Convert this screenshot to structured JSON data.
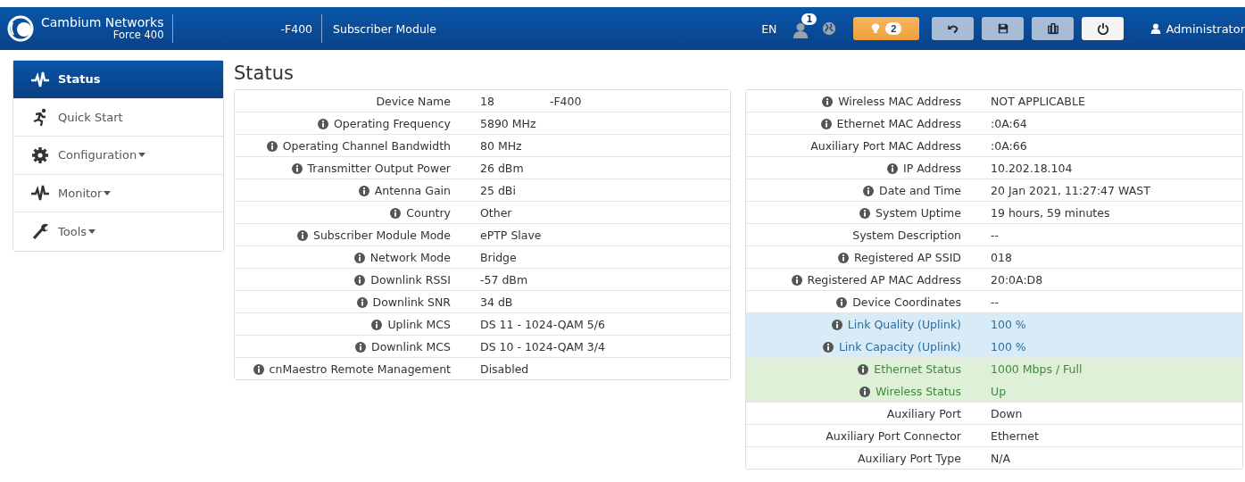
{
  "header": {
    "brand": "Cambium Networks",
    "model": "Force 400",
    "device_name": "-F400",
    "mode": "Subscriber Module",
    "language": "EN",
    "user_badge": "1",
    "alerts_badge": "2",
    "user": "Administrator"
  },
  "sidebar": {
    "items": [
      {
        "label": "Status",
        "dropdown": false,
        "selected": true
      },
      {
        "label": "Quick Start",
        "dropdown": false,
        "selected": false
      },
      {
        "label": "Configuration",
        "dropdown": true,
        "selected": false
      },
      {
        "label": "Monitor",
        "dropdown": true,
        "selected": false
      },
      {
        "label": "Tools",
        "dropdown": true,
        "selected": false
      }
    ]
  },
  "page_title": "Status",
  "left_table": {
    "rows": [
      {
        "label": "Device Name",
        "info": false,
        "value_parts": [
          "18",
          "-F400"
        ]
      },
      {
        "label": "Operating Frequency",
        "info": true,
        "value_parts": [
          "5890 MHz"
        ]
      },
      {
        "label": "Operating Channel Bandwidth",
        "info": true,
        "value_parts": [
          "80 MHz"
        ]
      },
      {
        "label": "Transmitter Output Power",
        "info": true,
        "value_parts": [
          "26 dBm"
        ]
      },
      {
        "label": "Antenna Gain",
        "info": true,
        "value_parts": [
          "25 dBi"
        ]
      },
      {
        "label": "Country",
        "info": true,
        "value_parts": [
          "Other"
        ]
      },
      {
        "label": "Subscriber Module Mode",
        "info": true,
        "value_parts": [
          "ePTP Slave"
        ]
      },
      {
        "label": "Network Mode",
        "info": true,
        "value_parts": [
          "Bridge"
        ]
      },
      {
        "label": "Downlink RSSI",
        "info": true,
        "value_parts": [
          "-57 dBm"
        ]
      },
      {
        "label": "Downlink SNR",
        "info": true,
        "value_parts": [
          "34 dB"
        ]
      },
      {
        "label": "Uplink MCS",
        "info": true,
        "value_parts": [
          "DS 11 - 1024-QAM 5/6"
        ]
      },
      {
        "label": "Downlink MCS",
        "info": true,
        "value_parts": [
          "DS 10 - 1024-QAM 3/4"
        ]
      },
      {
        "label": "cnMaestro Remote Management",
        "info": true,
        "value_parts": [
          "Disabled"
        ]
      }
    ]
  },
  "right_table": {
    "rows": [
      {
        "label": "Wireless MAC Address",
        "info": true,
        "value_parts": [
          "NOT APPLICABLE"
        ]
      },
      {
        "label": "Ethernet MAC Address",
        "info": true,
        "value_parts": [
          ":0A:64"
        ]
      },
      {
        "label": "Auxiliary Port MAC Address",
        "info": false,
        "value_parts": [
          ":0A:66"
        ]
      },
      {
        "label": "IP Address",
        "info": true,
        "value_parts": [
          "10.202.18.104"
        ]
      },
      {
        "label": "Date and Time",
        "info": true,
        "value_parts": [
          "20 Jan 2021, 11:27:47 WAST"
        ]
      },
      {
        "label": "System Uptime",
        "info": true,
        "value_parts": [
          "19 hours, 59 minutes"
        ]
      },
      {
        "label": "System Description",
        "info": false,
        "value_parts": [
          "--"
        ]
      },
      {
        "label": "Registered AP SSID",
        "info": true,
        "value_parts": [
          "018"
        ]
      },
      {
        "label": "Registered AP MAC Address",
        "info": true,
        "value_parts": [
          "20:0A:D8"
        ]
      },
      {
        "label": "Device Coordinates",
        "info": true,
        "value_parts": [
          "--"
        ]
      },
      {
        "label": "Link Quality (Uplink)",
        "info": true,
        "color": "#d9ebf6",
        "value_parts": [
          "100 %"
        ]
      },
      {
        "label": "Link Capacity (Uplink)",
        "info": true,
        "color": "#d9ebf6",
        "value_parts": [
          "100 %"
        ]
      },
      {
        "label": "Ethernet Status",
        "info": true,
        "color": "#dff0d8",
        "value_parts": [
          "1000 Mbps / Full"
        ]
      },
      {
        "label": "Wireless Status",
        "info": true,
        "color": "#dff0d8",
        "value_parts": [
          "Up"
        ]
      },
      {
        "label": "Auxiliary Port",
        "info": false,
        "value_parts": [
          "Down"
        ]
      },
      {
        "label": "Auxiliary Port Connector",
        "info": false,
        "value_parts": [
          "Ethernet"
        ]
      },
      {
        "label": "Auxiliary Port Type",
        "info": false,
        "value_parts": [
          "N/A"
        ]
      }
    ]
  }
}
